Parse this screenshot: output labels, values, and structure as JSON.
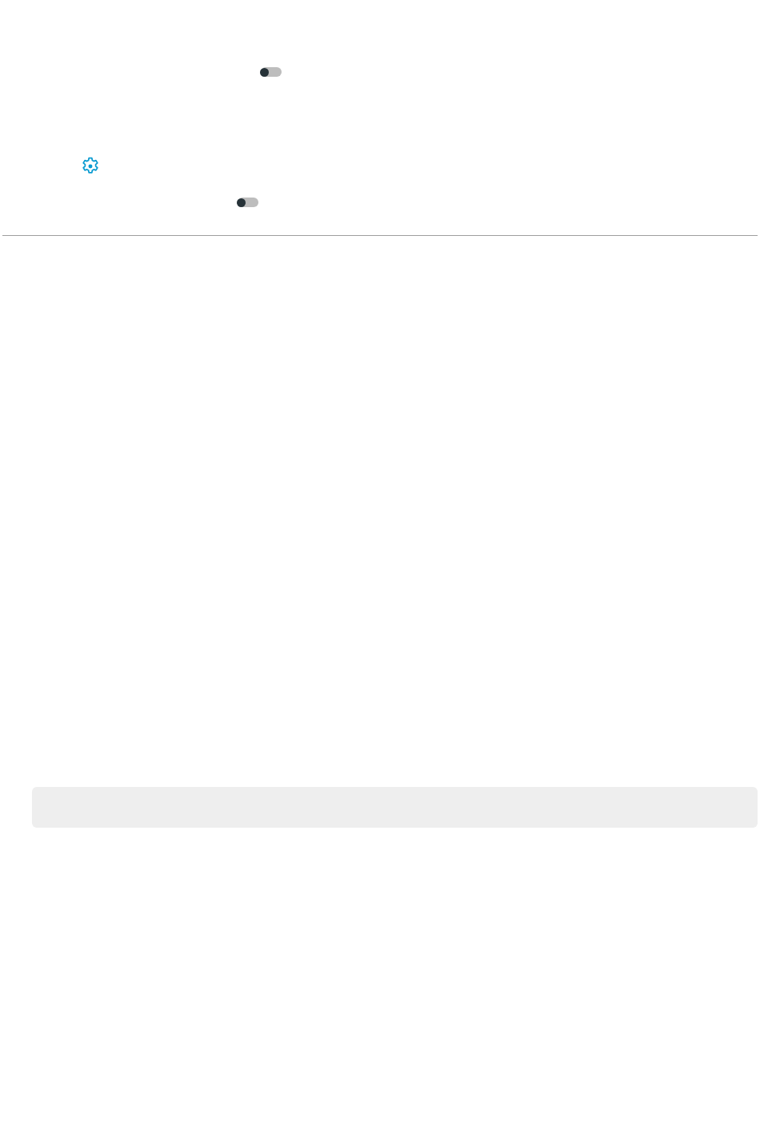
{
  "toggles": [
    {
      "on": false
    },
    {
      "on": false
    }
  ]
}
